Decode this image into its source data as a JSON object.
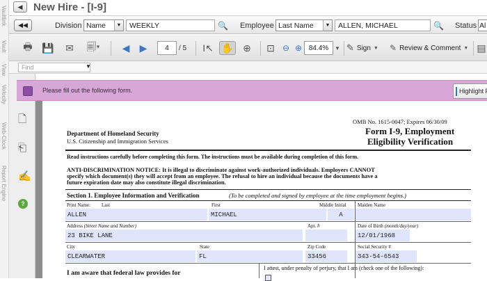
{
  "side_tabs": [
    "Vaultlink",
    "Vault",
    "View",
    "Velocity",
    "Web-Clock",
    "Report Engine"
  ],
  "window": {
    "title": "New Hire - [I-9]"
  },
  "filter_bar": {
    "division_label": "Division",
    "division_select": "Name",
    "division_value": "WEEKLY",
    "employee_label": "Employee",
    "employee_select": "Last Name",
    "employee_value": "ALLEN, MICHAEL",
    "status_label": "Status",
    "status_value": "Al"
  },
  "toolbar": {
    "page_current": "4",
    "page_total": "/ 5",
    "zoom": "84.4%",
    "sign_label": "Sign",
    "review_label": "Review & Comment"
  },
  "find": {
    "placeholder": "Find"
  },
  "banner": {
    "message": "Please fill out the following form.",
    "highlight_button": "Highlight Fiel"
  },
  "form": {
    "omb": "OMB No. 1615-0047; Expires 06/30/09",
    "dept": "Department of Homeland Security",
    "agency": "U.S. Citizenship and Immigration Services",
    "form_title_1": "Form I-9, Employment",
    "form_title_2": "Eligibility Verification",
    "read_instr": "Read instructions carefully before completing this form.  The instructions must be available during completion of this form.",
    "anti_1": "ANTI-DISCRIMINATION NOTICE:  It is illegal to discriminate against work-authorized individuals. Employers CANNOT",
    "anti_2": "specify which document(s) they will accept from an employee.  The refusal to hire an individual because the documents have a",
    "anti_3": "future expiration date may also constitute illegal discrimination.",
    "section1_bold": "Section 1. Employee Information and Verification",
    "section1_italic": "(To be completed and signed by employee at the time employment begins.)",
    "label_print_name": "Print Name:",
    "label_last": "Last",
    "label_first": "First",
    "label_middle": "Middle Initial",
    "label_maiden": "Maiden Name",
    "last_name": "ALLEN",
    "first_name": "MICHAEL",
    "middle_initial": "A",
    "maiden_name": "",
    "label_address": "Address",
    "label_address_note": "(Street Name and Number)",
    "label_apt": "Apt. #",
    "label_dob": "Date of Birth",
    "label_dob_note": "(month/day/year)",
    "address": "23 BIKE LANE",
    "apt": "",
    "dob": "12/01/1968",
    "label_city": "City",
    "label_state": "State",
    "label_zip": "Zip Code",
    "label_ssn": "Social Security #",
    "city": "CLEARWATER",
    "state": "FL",
    "zip": "33456",
    "ssn": "343-54-6543",
    "aware": "I am aware that federal law provides for",
    "attest": "I attest, under penalty of perjury, that I am (check one of the following):"
  }
}
